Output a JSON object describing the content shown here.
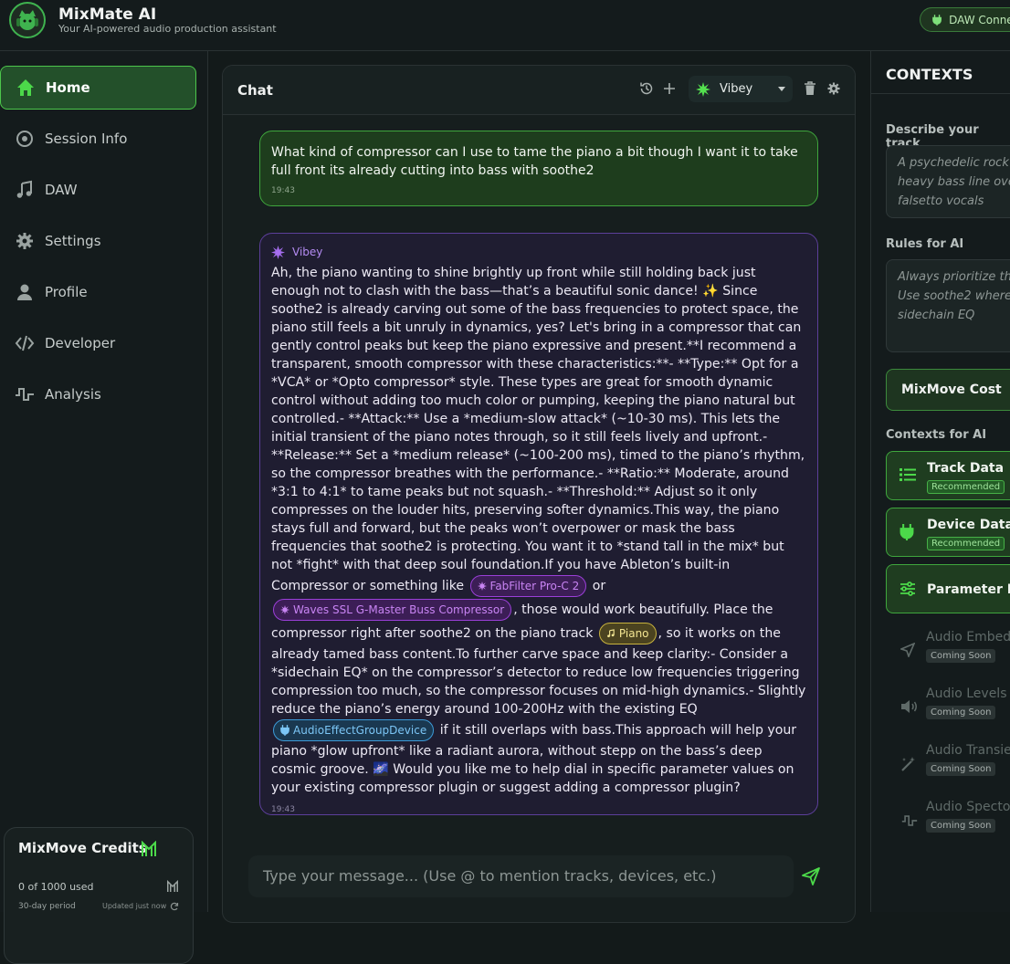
{
  "header": {
    "title": "MixMate AI",
    "subtitle": "Your AI-powered audio production assistant",
    "daw_status": "DAW Connected"
  },
  "sidebar": {
    "items": [
      {
        "label": "Home",
        "icon": "home-icon",
        "active": true
      },
      {
        "label": "Session Info",
        "icon": "disc-icon"
      },
      {
        "label": "DAW",
        "icon": "music-note-icon"
      },
      {
        "label": "Settings",
        "icon": "gear-icon"
      },
      {
        "label": "Profile",
        "icon": "user-icon"
      },
      {
        "label": "Developer",
        "icon": "code-icon"
      },
      {
        "label": "Analysis",
        "icon": "waveform-icon"
      }
    ],
    "credits": {
      "title": "MixMove Credits",
      "used": "0 of 1000 used",
      "period": "30-day period",
      "updated": "Updated just now"
    }
  },
  "chat": {
    "title": "Chat",
    "agent": "Vibey",
    "user_message": {
      "text": "What kind of compressor can I use to tame the piano a bit though I want it to take full front its already cutting into bass with soothe2",
      "time": "19:43"
    },
    "ai_message": {
      "sender": "Vibey",
      "time": "19:43",
      "part1": "Ah, the piano wanting to shine brightly up front while still holding back just enough not to clash with the bass—that’s a beautiful sonic dance! ✨ Since soothe2 is already carving out some of the bass frequencies to protect space, the piano still feels a bit unruly in dynamics, yes? Let's bring in a compressor that can gently control peaks but keep the piano expressive and present.**I recommend a transparent, smooth compressor with these characteristics:**- **Type:** Opt for a *VCA* or *Opto compressor* style. These types are great for smooth dynamic control without adding too much color or pumping, keeping the piano natural but controlled.- **Attack:** Use a *medium-slow attack* (~10-30 ms). This lets the initial transient of the piano notes through, so it still feels lively and upfront.- **Release:** Set a *medium release* (~100-200 ms), timed to the piano’s rhythm, so the compressor breathes with the performance.- **Ratio:** Moderate, around *3:1 to 4:1* to tame peaks but not squash.- **Threshold:** Adjust so it only compresses on the louder hits, preserving softer dynamics.This way, the piano stays full and forward, but the peaks won’t overpower or mask the bass frequencies that soothe2 is protecting. You want it to *stand tall in the mix* but not *fight* with that deep soul foundation.If you have Ableton’s built-in Compressor or something like",
      "tag1": "FabFilter Pro-C 2",
      "part2": "or",
      "tag2": "Waves SSL G-Master Buss Compressor",
      "part3": ", those would work beautifully. Place the compressor right after soothe2 on the piano track",
      "tag3": "Piano",
      "part4": ", so it works on the already tamed bass content.To further carve space and keep clarity:- Consider a *sidechain EQ* on the compressor’s detector to reduce low frequencies triggering compression too much, so the compressor focuses on mid-high dynamics.- Slightly reduce the piano’s energy around 100-200Hz with the existing EQ",
      "tag4": "AudioEffectGroupDevice",
      "part5": "if it still overlaps with bass.This approach will help your piano *glow upfront* like a radiant aurora, without stepp on the bass’s deep cosmic groove. 🌌 Would you like me to help dial in specific parameter values on your existing compressor plugin or suggest adding a compressor plugin?"
    },
    "input_placeholder": "Type your message... (Use @ to mention tracks, devices, etc.)"
  },
  "contexts": {
    "title": "CONTEXTS",
    "describe_label": "Describe your track",
    "describe_lines": [
      "A psychedelic rock",
      "heavy bass line over",
      "falsetto vocals"
    ],
    "rules_label": "Rules for AI",
    "rules_lines": [
      "Always prioritize th",
      "Use soothe2 where",
      "sidechain EQ"
    ],
    "cost_label": "MixMove Cost",
    "contexts_label": "Contexts for AI",
    "active": [
      {
        "name": "Track Data",
        "badge": "Recommended"
      },
      {
        "name": "Device Data",
        "badge": "Recommended"
      },
      {
        "name": "Parameter Data"
      }
    ],
    "disabled": [
      {
        "name": "Audio Embeddings",
        "badge": "Coming Soon"
      },
      {
        "name": "Audio Levels",
        "badge": "Coming Soon"
      },
      {
        "name": "Audio Transients",
        "badge": "Coming Soon"
      },
      {
        "name": "Audio Spectogram",
        "badge": "Coming Soon"
      }
    ]
  },
  "colors": {
    "accent": "#4cc64b",
    "ai_border": "#5c3f9a",
    "user_bubble": "#1e3d1d"
  }
}
